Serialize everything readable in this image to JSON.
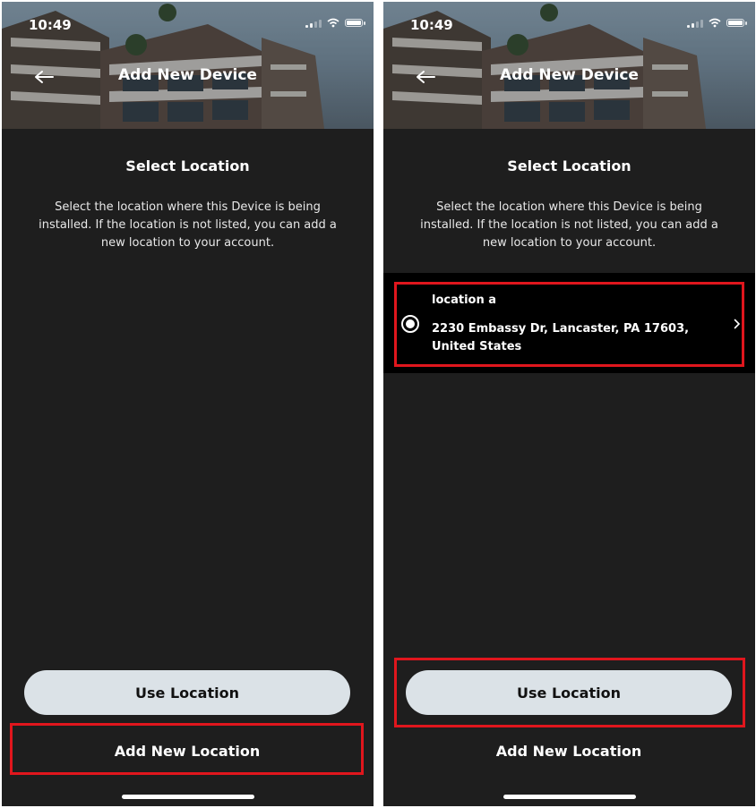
{
  "screens": [
    {
      "status_time": "10:49",
      "header_title": "Add New Device",
      "section_title": "Select Location",
      "description": "Select the location where this Device is being installed. If the location is not listed, you can add a new location to your account.",
      "locations": [],
      "use_location_label": "Use Location",
      "add_new_location_label": "Add New Location"
    },
    {
      "status_time": "10:49",
      "header_title": "Add New Device",
      "section_title": "Select Location",
      "description": "Select the location where this Device is being installed. If the location is not listed, you can add a new location to your account.",
      "locations": [
        {
          "name": "location a",
          "address": "2230 Embassy Dr, Lancaster, PA 17603, United States",
          "selected": true
        }
      ],
      "use_location_label": "Use Location",
      "add_new_location_label": "Add New Location"
    }
  ],
  "colors": {
    "background": "#1e1e1e",
    "list_background": "#000000",
    "primary_button": "#dbe2e7",
    "highlight": "#e0161d"
  },
  "icons": {
    "back": "arrow-left-icon",
    "radio": "radio-selected-icon",
    "chevron": "chevron-right-icon",
    "wifi": "wifi-icon",
    "battery": "battery-icon",
    "signal": "signal-icon"
  }
}
